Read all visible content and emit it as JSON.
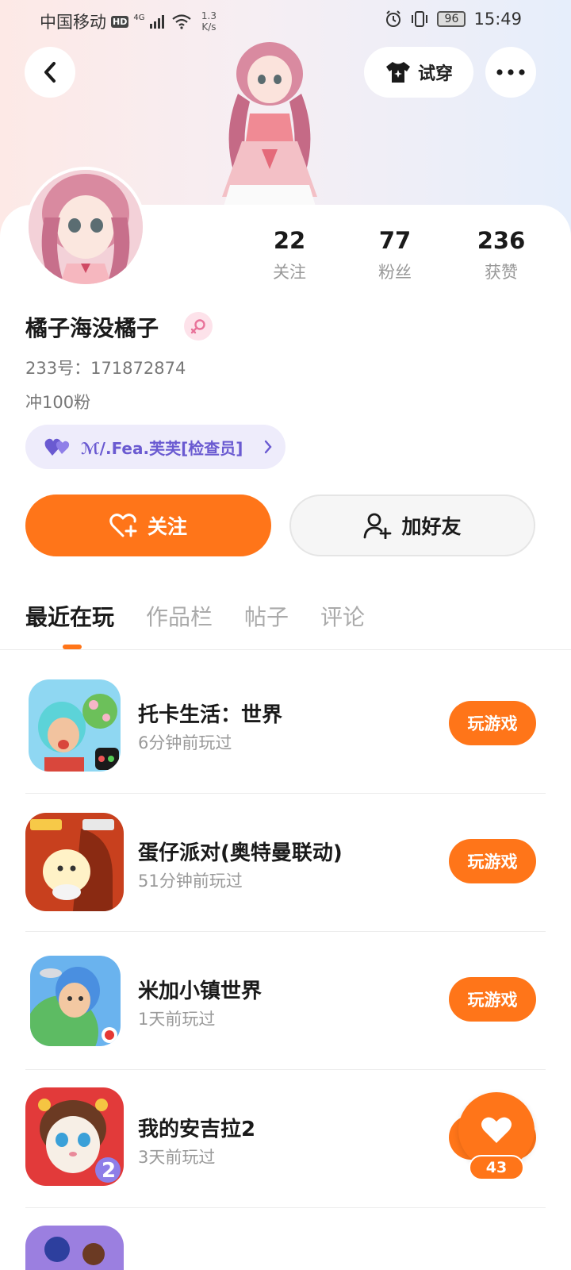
{
  "status_bar": {
    "carrier": "中国移动",
    "hd": "HD",
    "network": "4G",
    "net_speed_value": "1.3",
    "net_speed_unit": "K/s",
    "battery": "96",
    "time": "15:49"
  },
  "header": {
    "try_on_label": "试穿",
    "back_icon": "chevron-left-icon",
    "more_icon": "more-dots-icon",
    "try_on_icon": "shirt-sparkle-icon"
  },
  "profile": {
    "stats": [
      {
        "value": "22",
        "label": "关注"
      },
      {
        "value": "77",
        "label": "粉丝"
      },
      {
        "value": "236",
        "label": "获赞"
      }
    ],
    "username": "橘子海没橘子",
    "gender_icon": "female-icon",
    "uid": "233号：171872874",
    "bio": "冲100粉",
    "guild": {
      "name": "ℳ/.Fea.芙芙[检查员]",
      "icon": "double-heart-icon"
    }
  },
  "actions": {
    "follow_label": "关注",
    "add_friend_label": "加好友"
  },
  "tabs": [
    {
      "label": "最近在玩",
      "active": true
    },
    {
      "label": "作品栏",
      "active": false
    },
    {
      "label": "帖子",
      "active": false
    },
    {
      "label": "评论",
      "active": false
    }
  ],
  "games": [
    {
      "title": "托卡生活：世界",
      "time": "6分钟前玩过",
      "button": "玩游戏"
    },
    {
      "title": "蛋仔派对(奥特曼联动)",
      "time": "51分钟前玩过",
      "button": "玩游戏"
    },
    {
      "title": "米加小镇世界",
      "time": "1天前玩过",
      "button": "玩游戏"
    },
    {
      "title": "我的安吉拉2",
      "time": "3天前玩过",
      "button": "玩游戏"
    }
  ],
  "like_fab": {
    "count": "43",
    "icon": "heart-icon"
  },
  "colors": {
    "accent": "#ff7519",
    "guild_text": "#6a5ad1",
    "guild_bg": "#eeecfb"
  }
}
